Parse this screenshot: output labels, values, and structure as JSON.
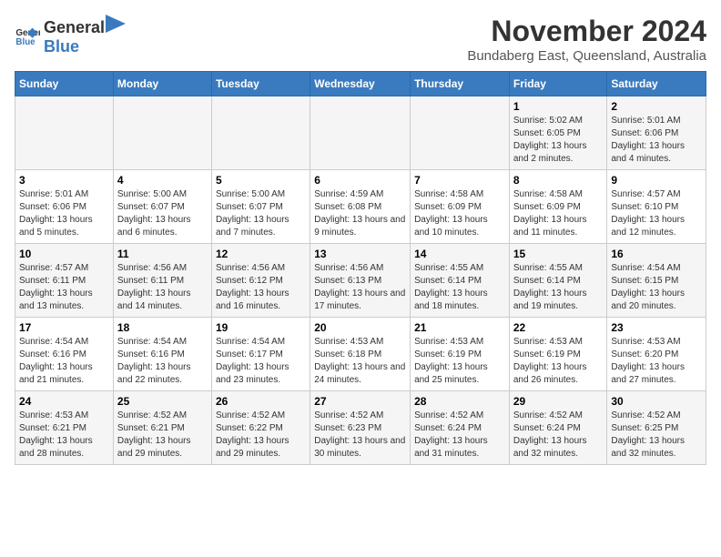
{
  "header": {
    "logo_general": "General",
    "logo_blue": "Blue",
    "main_title": "November 2024",
    "sub_title": "Bundaberg East, Queensland, Australia"
  },
  "weekdays": [
    "Sunday",
    "Monday",
    "Tuesday",
    "Wednesday",
    "Thursday",
    "Friday",
    "Saturday"
  ],
  "weeks": [
    [
      {
        "day": "",
        "sunrise": "",
        "sunset": "",
        "daylight": ""
      },
      {
        "day": "",
        "sunrise": "",
        "sunset": "",
        "daylight": ""
      },
      {
        "day": "",
        "sunrise": "",
        "sunset": "",
        "daylight": ""
      },
      {
        "day": "",
        "sunrise": "",
        "sunset": "",
        "daylight": ""
      },
      {
        "day": "",
        "sunrise": "",
        "sunset": "",
        "daylight": ""
      },
      {
        "day": "1",
        "sunrise": "Sunrise: 5:02 AM",
        "sunset": "Sunset: 6:05 PM",
        "daylight": "Daylight: 13 hours and 2 minutes."
      },
      {
        "day": "2",
        "sunrise": "Sunrise: 5:01 AM",
        "sunset": "Sunset: 6:06 PM",
        "daylight": "Daylight: 13 hours and 4 minutes."
      }
    ],
    [
      {
        "day": "3",
        "sunrise": "Sunrise: 5:01 AM",
        "sunset": "Sunset: 6:06 PM",
        "daylight": "Daylight: 13 hours and 5 minutes."
      },
      {
        "day": "4",
        "sunrise": "Sunrise: 5:00 AM",
        "sunset": "Sunset: 6:07 PM",
        "daylight": "Daylight: 13 hours and 6 minutes."
      },
      {
        "day": "5",
        "sunrise": "Sunrise: 5:00 AM",
        "sunset": "Sunset: 6:07 PM",
        "daylight": "Daylight: 13 hours and 7 minutes."
      },
      {
        "day": "6",
        "sunrise": "Sunrise: 4:59 AM",
        "sunset": "Sunset: 6:08 PM",
        "daylight": "Daylight: 13 hours and 9 minutes."
      },
      {
        "day": "7",
        "sunrise": "Sunrise: 4:58 AM",
        "sunset": "Sunset: 6:09 PM",
        "daylight": "Daylight: 13 hours and 10 minutes."
      },
      {
        "day": "8",
        "sunrise": "Sunrise: 4:58 AM",
        "sunset": "Sunset: 6:09 PM",
        "daylight": "Daylight: 13 hours and 11 minutes."
      },
      {
        "day": "9",
        "sunrise": "Sunrise: 4:57 AM",
        "sunset": "Sunset: 6:10 PM",
        "daylight": "Daylight: 13 hours and 12 minutes."
      }
    ],
    [
      {
        "day": "10",
        "sunrise": "Sunrise: 4:57 AM",
        "sunset": "Sunset: 6:11 PM",
        "daylight": "Daylight: 13 hours and 13 minutes."
      },
      {
        "day": "11",
        "sunrise": "Sunrise: 4:56 AM",
        "sunset": "Sunset: 6:11 PM",
        "daylight": "Daylight: 13 hours and 14 minutes."
      },
      {
        "day": "12",
        "sunrise": "Sunrise: 4:56 AM",
        "sunset": "Sunset: 6:12 PM",
        "daylight": "Daylight: 13 hours and 16 minutes."
      },
      {
        "day": "13",
        "sunrise": "Sunrise: 4:56 AM",
        "sunset": "Sunset: 6:13 PM",
        "daylight": "Daylight: 13 hours and 17 minutes."
      },
      {
        "day": "14",
        "sunrise": "Sunrise: 4:55 AM",
        "sunset": "Sunset: 6:14 PM",
        "daylight": "Daylight: 13 hours and 18 minutes."
      },
      {
        "day": "15",
        "sunrise": "Sunrise: 4:55 AM",
        "sunset": "Sunset: 6:14 PM",
        "daylight": "Daylight: 13 hours and 19 minutes."
      },
      {
        "day": "16",
        "sunrise": "Sunrise: 4:54 AM",
        "sunset": "Sunset: 6:15 PM",
        "daylight": "Daylight: 13 hours and 20 minutes."
      }
    ],
    [
      {
        "day": "17",
        "sunrise": "Sunrise: 4:54 AM",
        "sunset": "Sunset: 6:16 PM",
        "daylight": "Daylight: 13 hours and 21 minutes."
      },
      {
        "day": "18",
        "sunrise": "Sunrise: 4:54 AM",
        "sunset": "Sunset: 6:16 PM",
        "daylight": "Daylight: 13 hours and 22 minutes."
      },
      {
        "day": "19",
        "sunrise": "Sunrise: 4:54 AM",
        "sunset": "Sunset: 6:17 PM",
        "daylight": "Daylight: 13 hours and 23 minutes."
      },
      {
        "day": "20",
        "sunrise": "Sunrise: 4:53 AM",
        "sunset": "Sunset: 6:18 PM",
        "daylight": "Daylight: 13 hours and 24 minutes."
      },
      {
        "day": "21",
        "sunrise": "Sunrise: 4:53 AM",
        "sunset": "Sunset: 6:19 PM",
        "daylight": "Daylight: 13 hours and 25 minutes."
      },
      {
        "day": "22",
        "sunrise": "Sunrise: 4:53 AM",
        "sunset": "Sunset: 6:19 PM",
        "daylight": "Daylight: 13 hours and 26 minutes."
      },
      {
        "day": "23",
        "sunrise": "Sunrise: 4:53 AM",
        "sunset": "Sunset: 6:20 PM",
        "daylight": "Daylight: 13 hours and 27 minutes."
      }
    ],
    [
      {
        "day": "24",
        "sunrise": "Sunrise: 4:53 AM",
        "sunset": "Sunset: 6:21 PM",
        "daylight": "Daylight: 13 hours and 28 minutes."
      },
      {
        "day": "25",
        "sunrise": "Sunrise: 4:52 AM",
        "sunset": "Sunset: 6:21 PM",
        "daylight": "Daylight: 13 hours and 29 minutes."
      },
      {
        "day": "26",
        "sunrise": "Sunrise: 4:52 AM",
        "sunset": "Sunset: 6:22 PM",
        "daylight": "Daylight: 13 hours and 29 minutes."
      },
      {
        "day": "27",
        "sunrise": "Sunrise: 4:52 AM",
        "sunset": "Sunset: 6:23 PM",
        "daylight": "Daylight: 13 hours and 30 minutes."
      },
      {
        "day": "28",
        "sunrise": "Sunrise: 4:52 AM",
        "sunset": "Sunset: 6:24 PM",
        "daylight": "Daylight: 13 hours and 31 minutes."
      },
      {
        "day": "29",
        "sunrise": "Sunrise: 4:52 AM",
        "sunset": "Sunset: 6:24 PM",
        "daylight": "Daylight: 13 hours and 32 minutes."
      },
      {
        "day": "30",
        "sunrise": "Sunrise: 4:52 AM",
        "sunset": "Sunset: 6:25 PM",
        "daylight": "Daylight: 13 hours and 32 minutes."
      }
    ]
  ]
}
